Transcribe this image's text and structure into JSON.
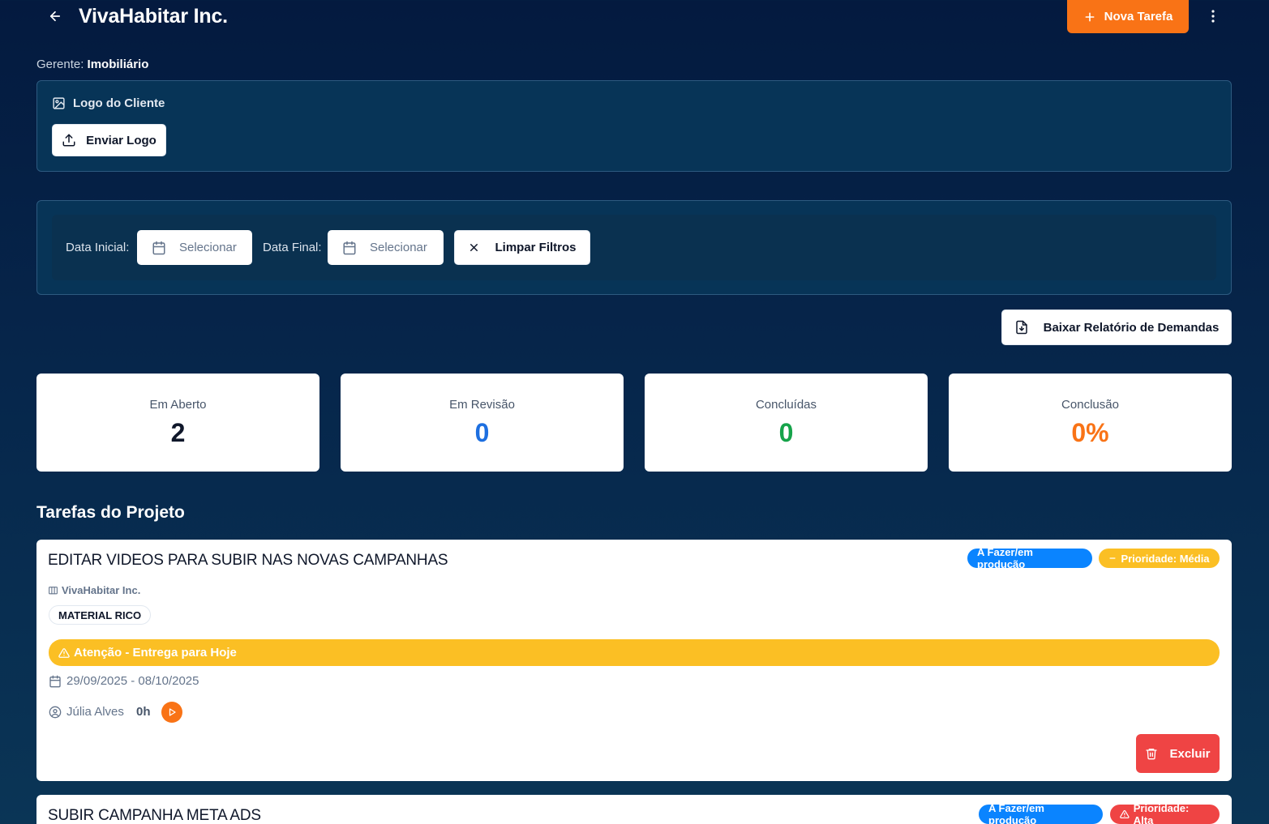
{
  "header": {
    "title": "VivaHabitar Inc.",
    "new_task_label": "Nova Tarefa",
    "manager_label": "Gerente:",
    "manager_value": "Imobiliário"
  },
  "logo_panel": {
    "heading": "Logo do Cliente",
    "upload_label": "Enviar Logo"
  },
  "filters": {
    "start_label": "Data Inicial:",
    "start_placeholder": "Selecionar",
    "end_label": "Data Final:",
    "end_placeholder": "Selecionar",
    "clear_label": "Limpar Filtros"
  },
  "report_button": "Baixar Relatório de Demandas",
  "stats": [
    {
      "label": "Em Aberto",
      "value": "2",
      "color": "#0f172a"
    },
    {
      "label": "Em Revisão",
      "value": "0",
      "color": "#1d6fe0"
    },
    {
      "label": "Concluídas",
      "value": "0",
      "color": "#16a34a"
    },
    {
      "label": "Conclusão",
      "value": "0%",
      "color": "#f97316"
    }
  ],
  "tasks_title": "Tarefas do Projeto",
  "tasks": [
    {
      "title": "EDITAR VIDEOS PARA SUBIR NAS NOVAS CAMPANHAS",
      "status": "A Fazer/em produção",
      "priority": "Prioridade: Média",
      "priority_icon": "minus-icon",
      "client": "VivaHabitar Inc.",
      "tag": "MATERIAL RICO",
      "alert": "Atenção - Entrega para Hoje",
      "dates": "29/09/2025 - 08/10/2025",
      "assignee": "Júlia Alves",
      "hours": "0h",
      "delete_label": "Excluir"
    },
    {
      "title": "SUBIR CAMPANHA META ADS",
      "status": "A Fazer/em produção",
      "priority": "Prioridade: Alta",
      "priority_icon": "warning-icon"
    }
  ],
  "colors": {
    "accent": "#f97316",
    "status_blue": "#0a84ff",
    "priority_medium": "#fbbf24",
    "priority_high": "#ef4444",
    "danger": "#ef4444"
  }
}
